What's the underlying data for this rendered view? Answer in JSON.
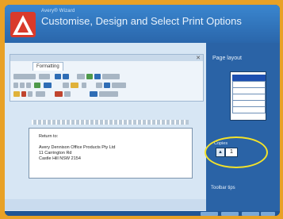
{
  "app": {
    "brand": "Avery® Wizard",
    "page_title": "Customise, Design and Select Print Options"
  },
  "document": {
    "tab_label": "Formatting",
    "address_lines": [
      "Return to:",
      "Avery Dennison Office Products Pty Ltd",
      "11 Carrington Rd",
      "Castle Hill NSW 2154"
    ]
  },
  "panel": {
    "layout_label": "Page layout",
    "copies_label": "Copies",
    "copies_value": "1",
    "toolbar_tips_label": "Toolbar tips"
  },
  "colors": {
    "background": "#e8a126",
    "window_blue": "#2c6fb7",
    "highlight": "#f3e22a"
  }
}
